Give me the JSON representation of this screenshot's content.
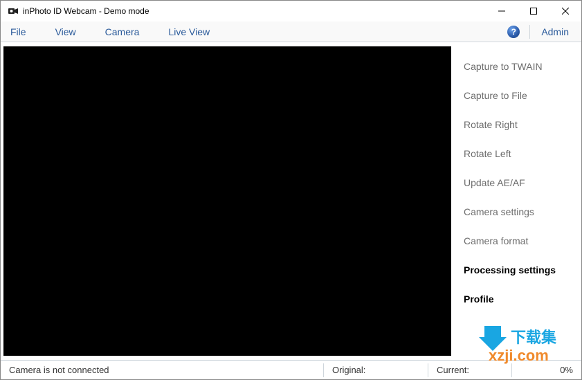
{
  "titlebar": {
    "app_icon": "camera-icon",
    "title": "inPhoto ID Webcam - Demo mode"
  },
  "menubar": {
    "items": [
      {
        "label": "File"
      },
      {
        "label": "View"
      },
      {
        "label": "Camera"
      },
      {
        "label": "Live View"
      }
    ],
    "help_glyph": "?",
    "admin_label": "Admin"
  },
  "side": {
    "items": [
      {
        "label": "Capture to TWAIN",
        "bold": false
      },
      {
        "label": "Capture to File",
        "bold": false
      },
      {
        "label": "Rotate Right",
        "bold": false
      },
      {
        "label": "Rotate Left",
        "bold": false
      },
      {
        "label": "Update AE/AF",
        "bold": false
      },
      {
        "label": "Camera settings",
        "bold": false
      },
      {
        "label": "Camera format",
        "bold": false
      },
      {
        "label": "Processing settings",
        "bold": true
      },
      {
        "label": "Profile",
        "bold": true
      }
    ]
  },
  "statusbar": {
    "camera_status": "Camera is not connected",
    "original_label": "Original:",
    "original_value": "",
    "current_label": "Current:",
    "current_value": "",
    "zoom_text": "0%"
  },
  "watermark": {
    "line1": "下载集",
    "line2": "xzji.com"
  }
}
